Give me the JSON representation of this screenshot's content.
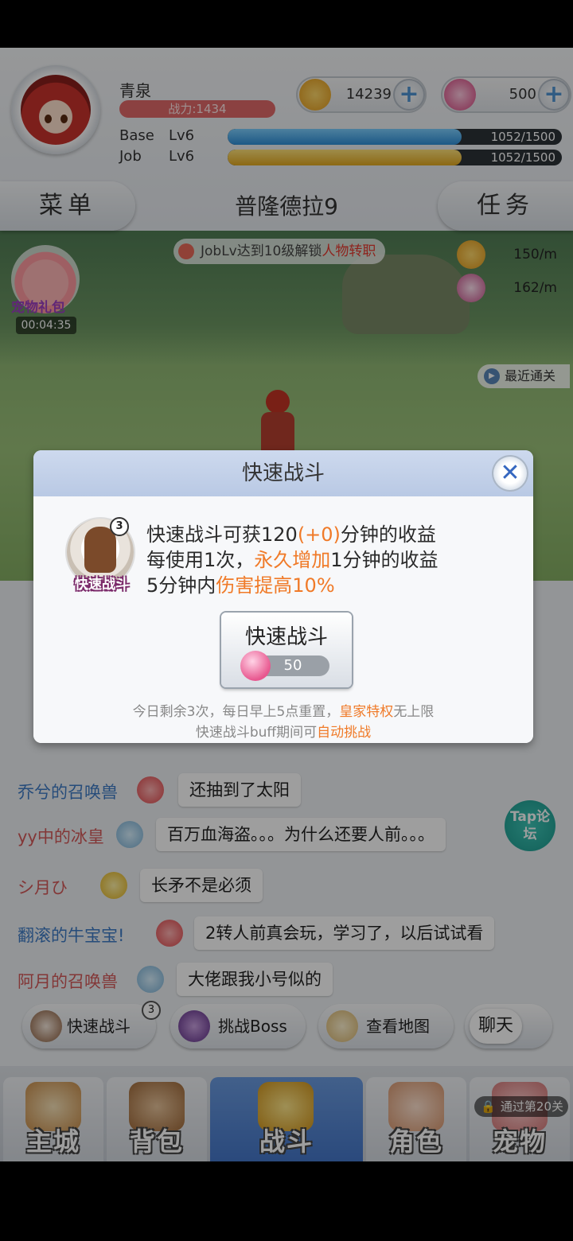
{
  "player": {
    "name": "青泉",
    "power": "战力:1434",
    "base_label": "Base",
    "base_lv": "Lv6",
    "base_exp": "1052/1500",
    "base_progress": 0.7,
    "job_label": "Job",
    "job_lv": "Lv6",
    "job_exp": "1052/1500",
    "job_progress": 0.7
  },
  "currency": {
    "gold": "14239",
    "gems": "500",
    "gold_icon": "gold-coin-icon",
    "gem_icon": "pink-gem-icon"
  },
  "nav": {
    "menu": "菜单",
    "stage": "普隆德拉9",
    "quest": "任务"
  },
  "scene": {
    "unlock_prefix": "JobLv达到10级解锁",
    "unlock_highlight": "人物转职",
    "pet_gift_label": "宠物礼包",
    "pet_gift_timer": "00:04:35",
    "gold_rate": "150/m",
    "exp_rate": "162/m",
    "recent_clear": "最近通关"
  },
  "chat": {
    "lines": [
      {
        "name": "乔兮的召唤兽",
        "text": "还抽到了太阳",
        "color": "blue"
      },
      {
        "name": "yy中的冰皇",
        "text": "百万血海盗。。。为什么还要人前。。。",
        "color": "red"
      },
      {
        "name": "シ月ひ",
        "text": "长矛不是必须",
        "color": "red"
      },
      {
        "name": "翻滚的牛宝宝!",
        "text": "2转人前真会玩，学习了，以后试试看",
        "color": "blue"
      },
      {
        "name": "阿月的召唤兽",
        "text": "大佬跟我小号似的",
        "color": "red"
      }
    ],
    "tap_forum": "Tap论坛"
  },
  "actions": {
    "quick_fight": "快速战斗",
    "quick_fight_badge": "3",
    "boss": "挑战Boss",
    "map": "查看地图",
    "chat_toggle": "聊天"
  },
  "tabs": {
    "city": "主城",
    "bag": "背包",
    "battle": "战斗",
    "role": "角色",
    "pet": "宠物",
    "pet_lock": "通过第20关"
  },
  "modal": {
    "title": "快速战斗",
    "skill_name": "快速战斗",
    "skill_badge": "3",
    "line1_a": "快速战斗可获120",
    "line1_hl": "(+0)",
    "line1_b": "分钟的收益",
    "line2_a": "每使用1次，",
    "line2_hl": "永久增加",
    "line2_b": "1分钟的收益",
    "line3_a": "5分钟内",
    "line3_hl": "伤害提高10%",
    "button_label": "快速战斗",
    "button_cost": "50",
    "note1_a": "今日剩余3次，每日早上5点重置，",
    "note1_hl": "皇家特权",
    "note1_b": "无上限",
    "note2_a": "快速战斗buff期间可",
    "note2_hl": "自动挑战"
  }
}
